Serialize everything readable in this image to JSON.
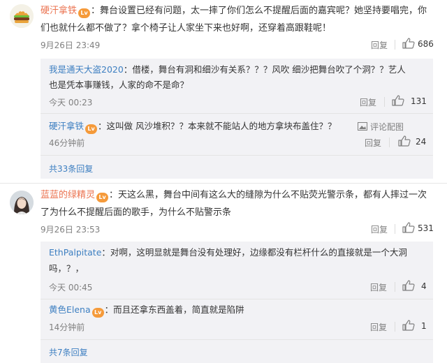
{
  "comments": [
    {
      "user": "硬汗拿铁",
      "badge": "Lv",
      "text_line1": "：舞台设置已经有问题，太一摔了你们怎么不提醒后面的嘉宾呢？她坚持要唱完，你",
      "text_line2": "们也就什么都不做了？拿个椅子让人家坐下来也好啊，还穿着高跟鞋呢！",
      "time": "9月26日 23:49",
      "reply_label": "回复",
      "likes": "686",
      "replies": [
        {
          "user": "我是通天大盗2020",
          "text_line1": "：借楼，舞台有洞和细沙有关系？？？风吹 细沙把舞台吹了个洞？？艺人",
          "text_line2": "也是凭本事赚钱，人家的命不是命？",
          "time": "今天 00:23",
          "reply_label": "回复",
          "likes": "131"
        },
        {
          "user": "硬汗拿铁",
          "text_line1": "：这叫做 风沙堆积？？本来就不能站人的地方拿块布盖住？？",
          "time": "46分钟前",
          "reply_label": "回复",
          "likes": "24",
          "report_label": "评论配图"
        }
      ],
      "more_label": "共33条回复"
    },
    {
      "user": "蓝蓝的绿精灵",
      "badge": "Lv",
      "text_line1": "：天这么黑，舞台中间有这么大的缝隙为什么不贴荧光警示条，都有人摔过一次",
      "text_line2": "了为什么不提醒后面的歌手，为什么不贴警示条",
      "time": "9月26日 23:53",
      "reply_label": "回复",
      "likes": "531",
      "replies": [
        {
          "user": "EthPalpitate",
          "text_line1": "：对啊，这明显就是舞台没有处理好，边缘都没有栏杆什么的直接就是一个大洞",
          "text_line2": "吗，？，",
          "time": "今天 00:45",
          "reply_label": "回复",
          "likes": "4"
        },
        {
          "user": "黄色Elena",
          "text_line1": "：而且还拿东西盖着，简直就是陷阱",
          "time": "14分钟前",
          "reply_label": "回复",
          "likes": "1"
        }
      ],
      "more_label": "共7条回复"
    }
  ]
}
